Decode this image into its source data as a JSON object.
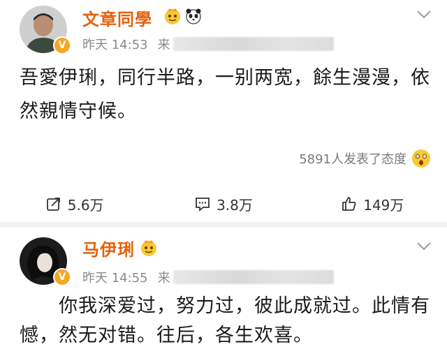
{
  "post1": {
    "username": "文章同學",
    "badge_icon": "verified-v-icon",
    "badge_label": "V",
    "time": "昨天 14:53",
    "source_label": "来",
    "content": "吾愛伊琍，同行半路，一别两宽，餘生漫漫，依然親情守候。",
    "reactions_text": "5891人发表了态度",
    "repost_count": "5.6万",
    "comment_count": "3.8万",
    "like_count": "149万"
  },
  "post2": {
    "username": "马伊琍",
    "badge_label": "V",
    "time": "昨天 14:55",
    "source_label": "来",
    "content": "你我深爱过，努力过，彼此成就过。此情有憾，然无对错。往后，各生欢喜。"
  },
  "colors": {
    "username": "#e5610c",
    "meta": "#8a8a8a",
    "badge": "#f5a623",
    "divider": "#f1f1f1"
  }
}
